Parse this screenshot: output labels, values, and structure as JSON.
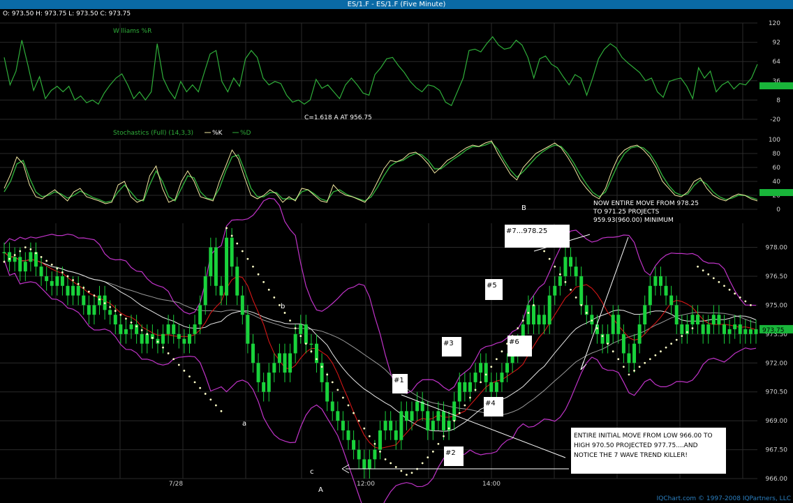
{
  "window": {
    "title": "ES/1.F - ES/1.F (Five Minute)",
    "ohlc": "O: 973.50   H: 973.75   L: 973.50   C: 973.75",
    "copyright": "IQChart.com © 1997-2008 IQPartners, LLC"
  },
  "colors": {
    "background": "#000000",
    "title_bar": "#0a6aa6",
    "green_indicator": "#2fae3a",
    "candle_up": "#19d23b",
    "price_label": "#19d23b",
    "ma_red": "#d41616",
    "ma_white": "#e8e8e8",
    "ma_gray": "#9a9a9a",
    "bollinger": "#c033c8",
    "parabolic_sar": "#ffffc8",
    "k_line": "#f1e7a0"
  },
  "chart_data": [
    {
      "type": "line",
      "title": "Williams %R",
      "y_ticks": [
        "120",
        "92",
        "64",
        "36",
        "8",
        "-20"
      ],
      "ylim": [
        -20,
        120
      ],
      "last_value_label": "",
      "series": [
        {
          "name": "",
          "values": [
            70,
            30,
            50,
            95,
            60,
            22,
            42,
            10,
            22,
            28,
            20,
            28,
            8,
            14,
            4,
            8,
            2,
            18,
            30,
            40,
            46,
            30,
            10,
            20,
            8,
            20,
            90,
            40,
            22,
            10,
            35,
            20,
            30,
            20,
            48,
            75,
            80,
            35,
            20,
            40,
            28,
            68,
            80,
            70,
            40,
            30,
            35,
            32,
            15,
            5,
            8,
            2,
            8,
            38,
            25,
            30,
            20,
            10,
            30,
            40,
            30,
            18,
            15,
            45,
            55,
            68,
            70,
            58,
            48,
            35,
            26,
            20,
            30,
            28,
            22,
            5,
            0,
            20,
            40,
            80,
            82,
            78,
            90,
            100,
            88,
            82,
            84,
            95,
            88,
            70,
            40,
            68,
            72,
            60,
            55,
            42,
            30,
            45,
            40,
            15,
            40,
            68,
            82,
            90,
            84,
            70,
            62,
            55,
            48,
            36,
            40,
            20,
            12,
            35,
            38,
            40,
            28,
            10,
            55,
            40,
            50,
            20,
            30,
            35,
            24,
            32,
            30,
            40,
            60
          ]
        }
      ]
    },
    {
      "type": "line",
      "title": "Stochastics (Full) (14,3,3)",
      "legend": [
        "%K",
        "%D"
      ],
      "y_ticks": [
        "100",
        "80",
        "60",
        "40",
        "20",
        "0"
      ],
      "ylim": [
        0,
        100
      ],
      "last_value_label": "",
      "series": [
        {
          "name": "%K",
          "values": [
            30,
            50,
            75,
            65,
            35,
            18,
            15,
            22,
            28,
            20,
            12,
            25,
            30,
            18,
            15,
            12,
            8,
            10,
            35,
            40,
            18,
            10,
            14,
            48,
            62,
            30,
            10,
            14,
            40,
            55,
            40,
            18,
            15,
            12,
            40,
            62,
            85,
            72,
            45,
            20,
            15,
            20,
            28,
            22,
            10,
            18,
            12,
            30,
            28,
            20,
            12,
            10,
            35,
            25,
            20,
            18,
            14,
            10,
            22,
            40,
            58,
            70,
            68,
            72,
            80,
            82,
            75,
            65,
            52,
            60,
            70,
            75,
            82,
            88,
            92,
            90,
            95,
            98,
            80,
            65,
            50,
            42,
            60,
            70,
            80,
            85,
            90,
            95,
            88,
            75,
            60,
            42,
            30,
            20,
            15,
            30,
            55,
            75,
            85,
            90,
            92,
            85,
            75,
            60,
            40,
            30,
            20,
            18,
            25,
            40,
            45,
            30,
            20,
            15,
            12,
            18,
            22,
            20,
            15,
            12
          ]
        },
        {
          "name": "%D",
          "values": [
            25,
            40,
            65,
            70,
            45,
            25,
            18,
            20,
            25,
            22,
            16,
            20,
            26,
            22,
            17,
            14,
            10,
            12,
            25,
            35,
            25,
            14,
            12,
            35,
            55,
            40,
            18,
            12,
            30,
            48,
            45,
            25,
            16,
            14,
            30,
            55,
            75,
            78,
            55,
            30,
            18,
            18,
            24,
            24,
            15,
            15,
            14,
            25,
            28,
            22,
            15,
            12,
            25,
            28,
            22,
            18,
            15,
            12,
            18,
            32,
            48,
            62,
            68,
            70,
            76,
            80,
            78,
            70,
            58,
            58,
            65,
            72,
            78,
            85,
            90,
            90,
            92,
            96,
            86,
            70,
            56,
            46,
            54,
            64,
            74,
            82,
            88,
            92,
            90,
            80,
            66,
            50,
            36,
            24,
            18,
            25,
            45,
            65,
            80,
            88,
            90,
            88,
            80,
            66,
            48,
            34,
            24,
            20,
            22,
            34,
            42,
            36,
            25,
            18,
            14,
            16,
            20,
            20,
            17,
            14
          ]
        }
      ]
    },
    {
      "type": "candlestick",
      "title": "",
      "x_ticks": [
        "7/28",
        "12:00",
        "14:00"
      ],
      "y_ticks": [
        "978.00",
        "976.50",
        "975.00",
        "973.50",
        "972.00",
        "970.50",
        "969.00",
        "967.50",
        "966.00"
      ],
      "ylim": [
        966.0,
        979.25
      ],
      "last_price_label": "973.75",
      "closes": [
        977.75,
        977.25,
        977.5,
        976.75,
        977.25,
        977.75,
        977.0,
        976.5,
        976.25,
        976.0,
        976.5,
        976.0,
        975.5,
        976.0,
        975.5,
        975.0,
        974.5,
        975.0,
        975.5,
        974.75,
        974.5,
        974.0,
        973.5,
        973.75,
        974.0,
        973.5,
        973.0,
        973.5,
        973.25,
        973.0,
        973.5,
        974.0,
        973.5,
        973.25,
        973.0,
        973.5,
        974.0,
        975.0,
        976.5,
        978.0,
        976.0,
        975.5,
        978.5,
        977.0,
        975.5,
        974.5,
        973.0,
        972.0,
        971.0,
        970.5,
        971.5,
        972.0,
        972.5,
        971.5,
        972.5,
        973.5,
        974.0,
        973.0,
        973.0,
        972.0,
        971.0,
        970.0,
        969.5,
        969.0,
        968.5,
        968.0,
        967.5,
        967.0,
        966.5,
        967.0,
        967.5,
        968.5,
        969.0,
        968.5,
        968.0,
        969.5,
        969.0,
        969.5,
        970.0,
        969.5,
        968.5,
        969.0,
        969.5,
        968.5,
        969.0,
        970.0,
        971.0,
        970.5,
        971.0,
        971.5,
        972.0,
        971.0,
        970.5,
        971.0,
        971.5,
        972.0,
        972.5,
        973.0,
        974.0,
        975.0,
        974.0,
        974.5,
        974.0,
        975.5,
        976.0,
        976.5,
        977.5,
        977.0,
        976.5,
        975.0,
        974.5,
        974.0,
        973.5,
        973.0,
        973.5,
        974.5,
        973.5,
        972.5,
        972.0,
        973.0,
        974.0,
        975.0,
        976.0,
        976.5,
        976.0,
        975.5,
        975.0,
        974.0,
        973.5,
        974.0,
        974.5,
        974.0,
        973.5,
        974.0,
        974.5,
        974.0,
        973.5,
        973.75,
        974.0,
        973.5,
        973.75,
        973.5,
        973.75
      ],
      "sar": [
        977.25,
        977.4,
        977.6,
        977.8,
        978.0,
        977.9,
        977.7,
        977.5,
        977.3,
        977.1,
        976.9,
        976.7,
        976.5,
        976.3,
        976.1,
        975.9,
        975.7,
        975.5,
        975.3,
        975.1,
        974.9,
        974.7,
        974.5,
        974.3,
        974.1,
        973.9,
        973.7,
        973.5,
        973.3,
        973.1,
        972.8,
        972.5,
        972.2,
        971.9,
        971.6,
        971.3,
        971.0,
        970.7,
        970.4,
        970.1,
        969.8,
        969.5,
        979.0,
        978.6,
        978.2,
        977.8,
        977.4,
        977.0,
        976.6,
        976.2,
        975.8,
        975.4,
        975.0,
        974.6,
        974.2,
        973.8,
        973.4,
        973.0,
        972.6,
        972.2,
        971.8,
        971.4,
        971.0,
        970.6,
        970.2,
        969.8,
        969.4,
        969.0,
        968.6,
        968.2,
        967.8,
        967.4,
        967.0,
        966.8,
        966.6,
        966.4,
        966.2,
        966.3,
        966.5,
        966.8,
        967.1,
        967.4,
        967.8,
        968.2,
        968.6,
        969.0,
        969.4,
        969.8,
        970.2,
        970.6,
        971.0,
        971.4,
        971.8,
        972.2,
        972.6,
        973.0,
        973.4,
        973.8,
        974.2,
        974.6,
        975.0,
        978.2,
        977.8,
        977.4,
        977.0,
        976.6,
        976.2,
        975.8,
        975.4,
        975.0,
        974.6,
        974.2,
        973.8,
        973.4,
        973.0,
        972.6,
        972.2,
        971.8,
        971.4,
        971.6,
        971.8,
        972.0,
        972.2,
        972.4,
        972.6,
        972.8,
        973.0,
        973.2,
        973.4,
        973.6,
        973.8,
        977.0,
        976.8,
        976.6,
        976.4,
        976.2,
        976.0,
        975.8,
        975.6,
        975.4,
        975.2,
        975.0
      ]
    }
  ],
  "annotations": {
    "c_projection": "C=1.618 A AT 956.75",
    "labels": {
      "a": "a",
      "b": "b",
      "c": "c",
      "A": "A",
      "B": "B"
    },
    "boxes": {
      "n1": "#1",
      "n2": "#2",
      "n3": "#3",
      "n4": "#4",
      "n5": "#5",
      "n6": "#6",
      "n7": "#7...978.25"
    },
    "note_top": [
      "NOW ENTIRE MOVE FROM 978.25",
      "TO 971.25 PROJECTS",
      "959.93(960.00) MINIMUM"
    ],
    "note_bottom": [
      "ENTIRE INITIAL MOVE FROM LOW 966.00 TO",
      "HIGH 970.50 PROJECTED 977.75....AND",
      "NOTICE THE 7 WAVE TREND KILLER!"
    ]
  }
}
